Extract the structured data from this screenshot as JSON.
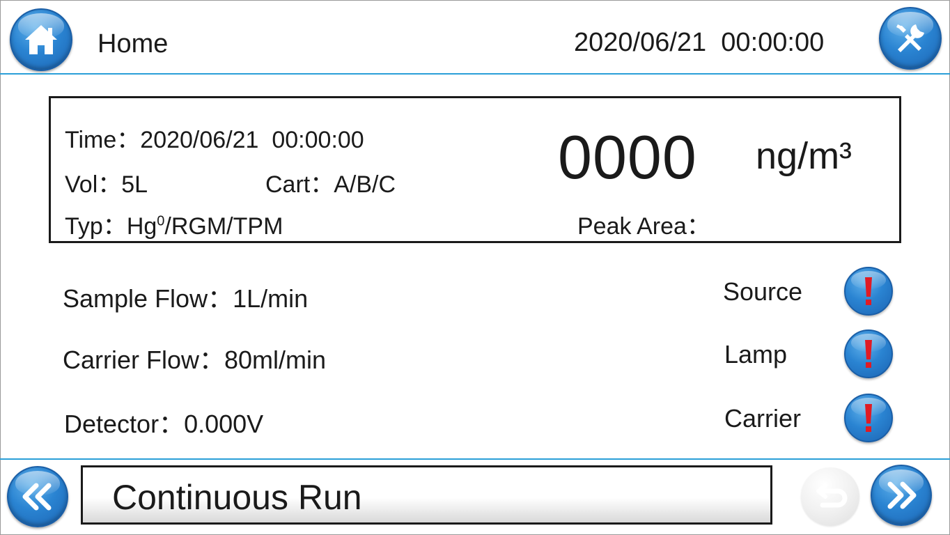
{
  "header": {
    "title": "Home",
    "datetime": "2020/06/21  00:00:00",
    "home_icon": "home-icon",
    "settings_icon": "tools-icon"
  },
  "measurement": {
    "time_label": "Time：",
    "time_value": "2020/06/21  00:00:00",
    "vol_label": "Vol：",
    "vol_value": "5L",
    "cart_label": "Cart：",
    "cart_value": "A/B/C",
    "typ_label": "Typ：",
    "typ_value_prefix": "Hg",
    "typ_value_sup": "0",
    "typ_value_suffix": "/RGM/TPM",
    "value": "0000",
    "unit": "ng/m³",
    "peak_area_label": "Peak Area："
  },
  "readings": [
    {
      "label": "Sample Flow：",
      "value": "1L/min"
    },
    {
      "label": "Carrier Flow：",
      "value": "80ml/min"
    },
    {
      "label": "Detector：",
      "value": "0.000V"
    }
  ],
  "statuses": [
    {
      "label": "Source",
      "icon": "exclamation-icon"
    },
    {
      "label": "Lamp",
      "icon": "exclamation-icon"
    },
    {
      "label": "Carrier",
      "icon": "exclamation-icon"
    }
  ],
  "footer": {
    "mode": "Continuous Run",
    "prev_icon": "double-chevron-left-icon",
    "next_icon": "double-chevron-right-icon",
    "back_icon": "return-icon"
  },
  "colors": {
    "accent": "#2a9fd8",
    "button_blue": "#2a84d2",
    "alert_red": "#e01b24"
  }
}
